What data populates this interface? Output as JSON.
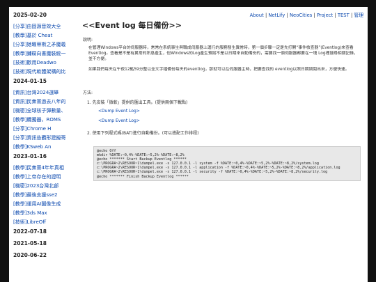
{
  "sidebar": {
    "groups": [
      {
        "date": "2025-02-20",
        "items": [
          "[分享]由固源音效大全",
          "[教學]基於 Cheat",
          "[分享]她曜蒂斯之矛魔羲",
          "[教學]鋪碟向書魔裝統一"
        ]
      },
      {
        "date": "",
        "items": [
          "[技術]歡用Deadwo",
          "[技術]現代軟體架構的比"
        ]
      },
      {
        "date": "2024-01-15",
        "items": [
          "[資訊]台灣2024選舉",
          "[資訊]民衆黨過去八年的",
          "[機密]全球核子彈數量、",
          "[教學]纜獨器，ROMS",
          "[分享]Chrome H",
          "[分享]資訊告覇形建擬哥",
          "[教學]KSweb An"
        ]
      },
      {
        "date": "2023-01-16",
        "items": [
          "[教學]民衆黨4年年真相",
          "[教學]上帝存在的證明",
          "[機密]2023台灣北部",
          "[教學]最後支援sse2",
          "[教學]運用AI圖像生成",
          "[教學]3ds Max",
          "[技術]LibreOff"
        ]
      },
      {
        "date": "2022-07-18",
        "items": []
      },
      {
        "date": "2021-05-18",
        "items": []
      },
      {
        "date": "2020-06-22",
        "items": []
      }
    ]
  },
  "topnav": {
    "about": "About",
    "netlify": "NetLify",
    "neocities": "NeoCities",
    "project": "Project",
    "test": "TEST",
    "admin": "管理",
    "sep": "|"
  },
  "article": {
    "title": "<<Event log 每日備份>>",
    "desc_label": "說明:",
    "para1": "在管理Windows平台的伺服器時，常常在系統事生與職成伺服器上運行的服務發生異常時，第一個步驟一定是先打開“事件檢查器”(Eventlog)來查看Eventlog。查看是不是有異常的訊息產生，但Windows的Log產生預設不是以日期來自動備份的，需要找一個伺服器都要在一塊 Log裡搜尋相關記錄，並不方便。",
    "para2": "如果我們每天在午夜12點59分整以全文字檔備份每天的eventlog，那就可以在伺服器主時，把要查找的 eventlog以照日期調閱出來，方便快速。",
    "method_label": "方法:",
    "step1": "1. 先安裝「微軟」提供的匯出工具。(提供兩個下載點)",
    "link1": "<Dump Event Log>",
    "link2": "<Dump Event Log>",
    "step2": "2. 使用下列程式碼(BAT)進行自動備份。(可以搭配工作排程)",
    "code": [
      "@echo Off",
      "mkdir %DATE:~0,4%-%DATE:~5,2%-%DATE:~8,2%",
      "@echo ******* Start Backup Eventlog ******",
      "c:\\PROGRA~2\\RESOUR~1\\dumpel.exe -s 127.0.0.1 -l system -f %DATE:~0,4%-%DATE:~5,2%-%DATE:~8,2%/system.log",
      "c:\\PROGRA~2\\RESOUR~1\\dumpel.exe -s 127.0.0.1 -l application -f %DATE:~0,4%-%DATE:~5,2%-%DATE:~8,2%/application.log",
      "c:\\PROGRA~2\\RESOUR~1\\dumpel.exe -s 127.0.0.1 -l security -f %DATE:~0,4%-%DATE:~5,2%-%DATE:~8,2%/security.log",
      "@echo ******* Finish Backup Eventlog ******"
    ]
  }
}
